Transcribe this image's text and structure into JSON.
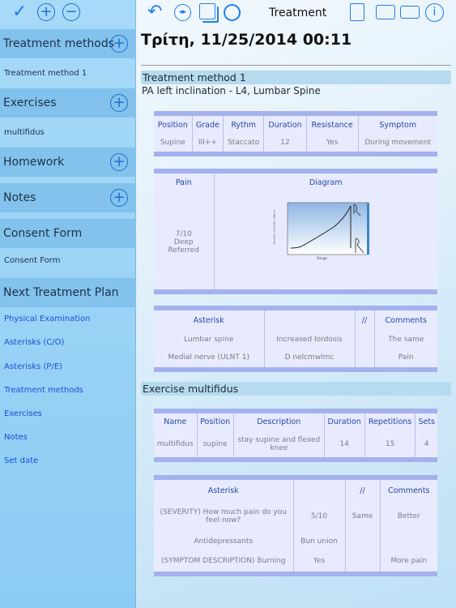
{
  "sidebar": {
    "sections": [
      {
        "title": "Treatment methods",
        "item": "Treatment method 1"
      },
      {
        "title": "Exercises",
        "item": "multifidus"
      },
      {
        "title": "Homework"
      },
      {
        "title": "Notes"
      },
      {
        "title": "Consent Form",
        "item": "Consent Form"
      },
      {
        "title": "Next Treatment Plan"
      }
    ],
    "links": [
      "Physical Examination",
      "Asterisks (C/O)",
      "Asterisks (P/E)",
      "Treatment methods",
      "Exercises",
      "Notes",
      "Set date"
    ]
  },
  "header": {
    "title": "Treatment"
  },
  "main": {
    "date": "Τρίτη, 11/25/2014 00:11",
    "treatment": {
      "band": "Treatment method 1",
      "desc": "PA left inclination - L4, Lumbar Spine",
      "headers": [
        "Position",
        "Grade",
        "Rythm",
        "Duration",
        "Resistance",
        "Symptom"
      ],
      "row": [
        "Supine",
        "III++",
        "Staccato",
        "12",
        "Yes",
        "During movement"
      ]
    },
    "pain": {
      "header": "Pain",
      "values": [
        "7/10",
        "Deep",
        "Referred"
      ],
      "diagram_header": "Diagram",
      "diagram_xlabel": "Range",
      "diagram_ylabel": "Severity / Irritability / Nature"
    },
    "asterisk1": {
      "headers": [
        "Asterisk",
        "",
        "//",
        "Comments"
      ],
      "rows": [
        [
          "Lumbar spine",
          "Increased lordosis",
          "",
          "The same"
        ],
        [
          "Medial nerve (ULNT 1)",
          "D nelcmwlmc",
          "",
          "Pain"
        ]
      ]
    },
    "exercise": {
      "band": "Exercise multifidus",
      "headers": [
        "Name",
        "Position",
        "Description",
        "Duration",
        "Repetitions",
        "Sets"
      ],
      "row": [
        "multifidus",
        "supine",
        "stay supine and flexed knee",
        "14",
        "15",
        "4"
      ]
    },
    "asterisk2": {
      "headers": [
        "Asterisk",
        "",
        "//",
        "Comments"
      ],
      "rows": [
        [
          "(SEVERITY) How much pain do you feel now?",
          "5/10",
          "Same",
          "Better"
        ],
        [
          "Antidepressants",
          "Bun union",
          "",
          ""
        ],
        [
          "(SYMPTOM DESCRIPTION) Burning",
          "Yes",
          "",
          "More pain"
        ]
      ]
    }
  }
}
